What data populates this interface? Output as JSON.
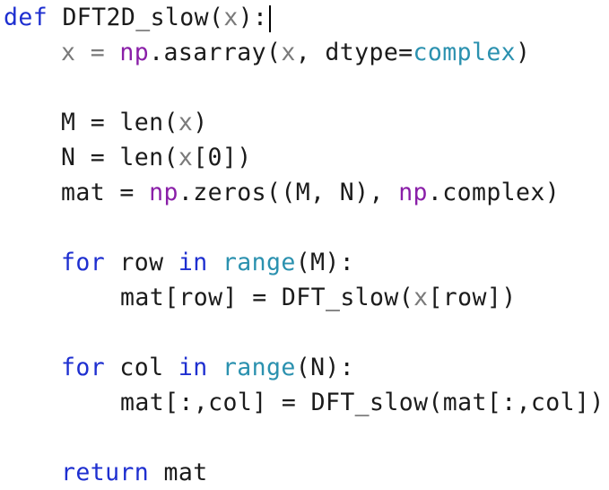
{
  "code": {
    "l1": {
      "def": "def",
      "name": "DFT2D_slow",
      "open": "(",
      "param": "x",
      "close": "):"
    },
    "l2": {
      "lhs": "x = ",
      "np": "np",
      "call": ".asarray(",
      "arg": "x",
      "mid": ", dtype=",
      "type": "complex",
      "end": ")"
    },
    "l4": {
      "text": "M = len(",
      "arg": "x",
      "end": ")"
    },
    "l5": {
      "text": "N = len(",
      "arg": "x",
      "end": "[0])"
    },
    "l6": {
      "lhs": "mat = ",
      "np1": "np",
      "call": ".zeros((M, N), ",
      "np2": "np",
      "end": ".complex)"
    },
    "l8": {
      "kw_for": "for",
      "var": " row ",
      "kw_in": "in",
      "sp": " ",
      "bi": "range",
      "end": "(M):"
    },
    "l9": {
      "lhs": "mat[row] = DFT_slow(",
      "arg": "x",
      "end": "[row])"
    },
    "l11": {
      "kw_for": "for",
      "var": " col ",
      "kw_in": "in",
      "sp": " ",
      "bi": "range",
      "end": "(N):"
    },
    "l12": {
      "text": "mat[:,col] = DFT_slow(mat[:,col])"
    },
    "l14": {
      "kw_return": "return",
      "end": " mat"
    }
  }
}
